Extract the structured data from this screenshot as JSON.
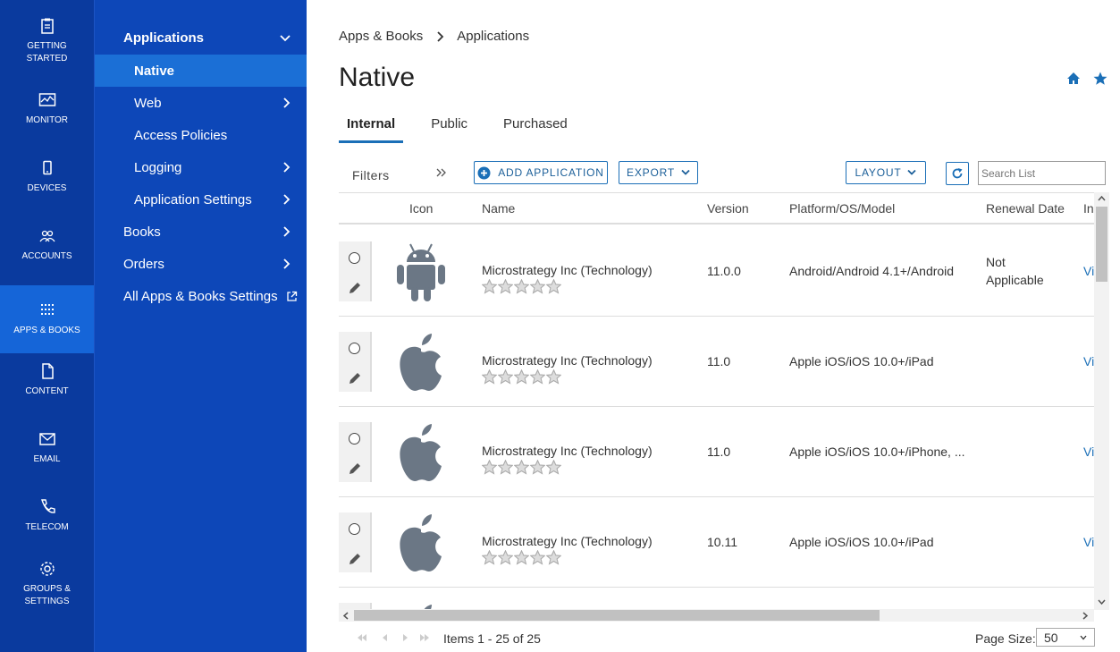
{
  "rail": [
    {
      "label": "GETTING\nSTARTED",
      "icon": "clipboard-icon"
    },
    {
      "label": "MONITOR",
      "icon": "monitor-icon"
    },
    {
      "label": "DEVICES",
      "icon": "device-icon"
    },
    {
      "label": "ACCOUNTS",
      "icon": "users-icon"
    },
    {
      "label": "APPS & BOOKS",
      "icon": "apps-grid-icon"
    },
    {
      "label": "CONTENT",
      "icon": "document-icon"
    },
    {
      "label": "EMAIL",
      "icon": "envelope-icon"
    },
    {
      "label": "TELECOM",
      "icon": "phone-icon"
    },
    {
      "label": "GROUPS &\nSETTINGS",
      "icon": "gear-icon"
    }
  ],
  "subnav": {
    "applications": "Applications",
    "native": "Native",
    "web": "Web",
    "access_policies": "Access Policies",
    "logging": "Logging",
    "application_settings": "Application Settings",
    "books": "Books",
    "orders": "Orders",
    "all_settings": "All Apps & Books Settings"
  },
  "breadcrumb": {
    "root": "Apps & Books",
    "current": "Applications"
  },
  "title": "Native",
  "tabs": [
    "Internal",
    "Public",
    "Purchased"
  ],
  "toolbar": {
    "filters": "Filters",
    "add_application": "ADD APPLICATION",
    "export": "EXPORT",
    "layout": "LAYOUT",
    "search_placeholder": "Search List"
  },
  "columns": {
    "icon": "Icon",
    "name": "Name",
    "version": "Version",
    "platform": "Platform/OS/Model",
    "renewal": "Renewal Date",
    "last": "In"
  },
  "rows": [
    {
      "name": "Microstrategy Inc (Technology)",
      "version": "11.0.0",
      "platform": "Android/Android 4.1+/Android",
      "renewal_line1": "Not",
      "renewal_line2": "Applicable",
      "link": "Vi",
      "os": "android",
      "rating": 0
    },
    {
      "name": "Microstrategy Inc (Technology)",
      "version": "11.0",
      "platform": "Apple iOS/iOS 10.0+/iPad",
      "renewal_line1": "",
      "renewal_line2": "",
      "link": "Vi",
      "os": "apple",
      "rating": 0
    },
    {
      "name": "Microstrategy Inc (Technology)",
      "version": "11.0",
      "platform": "Apple iOS/iOS 10.0+/iPhone, ...",
      "renewal_line1": "",
      "renewal_line2": "",
      "link": "Vi",
      "os": "apple",
      "rating": 0
    },
    {
      "name": "Microstrategy Inc (Technology)",
      "version": "10.11",
      "platform": "Apple iOS/iOS 10.0+/iPad",
      "renewal_line1": "",
      "renewal_line2": "",
      "link": "Vi",
      "os": "apple",
      "rating": 0
    }
  ],
  "pager": {
    "items_text": "Items 1 - 25 of 25",
    "page_size_label": "Page Size:",
    "page_size": "50"
  },
  "colors": {
    "rail_bg": "#0a3a9e",
    "subnav_bg": "#0d47b8",
    "active": "#1b6fd6",
    "accent": "#1b6fb7",
    "icon_gray": "#6b7785"
  }
}
